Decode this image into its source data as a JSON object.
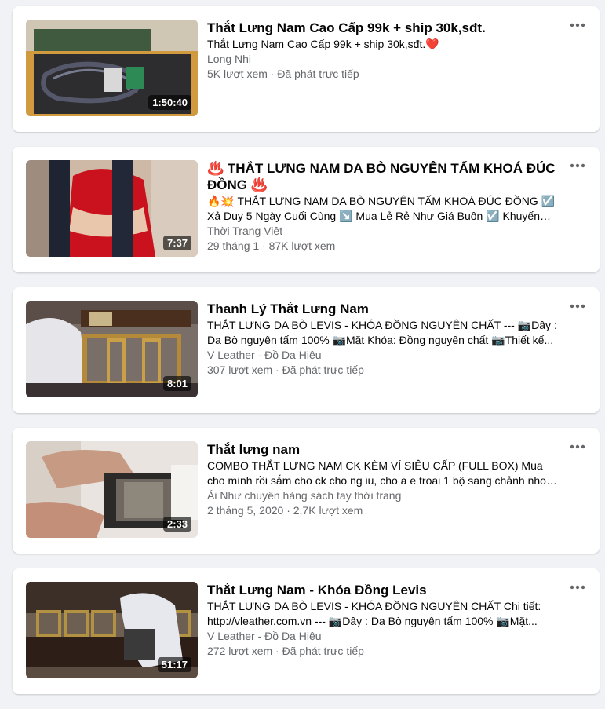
{
  "videos": [
    {
      "title": "Thắt Lưng Nam Cao Cấp 99k + ship 30k,sđt.",
      "description": "Thắt Lưng Nam Cao Cấp 99k + ship 30k,sđt.❤️",
      "channel": "Long Nhi",
      "meta": "5K lượt xem · Đã phát trực tiếp",
      "duration": "1:50:40"
    },
    {
      "title": "♨️ THẮT LƯNG NAM DA BÒ NGUYÊN TẤM KHOÁ ĐÚC ĐỒNG ♨️",
      "description": "🔥💥 THẮT LƯNG NAM DA BÒ NGUYÊN TẤM KHOÁ ĐÚC ĐỒNG ☑️ Xả Duy 5 Ngày Cuối Cùng ↘️ Mua Lẻ Rẻ Như Giá Buôn ☑️ Khuyến mãi C...",
      "channel": "Thời Trang Việt",
      "meta": "29 tháng 1 · 87K lượt xem",
      "duration": "7:37"
    },
    {
      "title": "Thanh Lý Thắt Lưng Nam",
      "description": "THẮT LƯNG DA BÒ LEVIS - KHÓA ĐỒNG NGUYÊN CHẤT --- 📷Dây : Da Bò nguyên tấm 100% 📷Mặt Khóa: Đồng nguyên chất 📷Thiết kế...",
      "channel": "V Leather - Đồ Da Hiệu",
      "meta": "307 lượt xem · Đã phát trực tiếp",
      "duration": "8:01"
    },
    {
      "title": "Thắt lưng nam",
      "description": "COMBO THẮT LƯNG NAM CK KÈM VÍ SIÊU CẤP (FULL BOX) Mua cho mình rồi sắm cho ck cho ng iu, cho a e troai 1 bộ sang chảnh nhoa ...",
      "channel": "Ái Như chuyên hàng sách tay thời trang",
      "meta": "2 tháng 5, 2020 · 2,7K lượt xem",
      "duration": "2:33"
    },
    {
      "title": "Thắt Lưng Nam - Khóa Đồng Levis",
      "description": "THẮT LƯNG DA BÒ LEVIS - KHÓA ĐỒNG NGUYÊN CHẤT Chi tiết: http://vleather.com.vn --- 📷Dây : Da Bò nguyên tấm 100% 📷Mặt...",
      "channel": "V Leather - Đồ Da Hiệu",
      "meta": "272 lượt xem · Đã phát trực tiếp",
      "duration": "51:17"
    }
  ],
  "icons": {
    "more": "more-horizontal-icon"
  },
  "colors": {
    "background": "#f0f2f5",
    "card": "#ffffff",
    "secondary_text": "#65676b"
  }
}
